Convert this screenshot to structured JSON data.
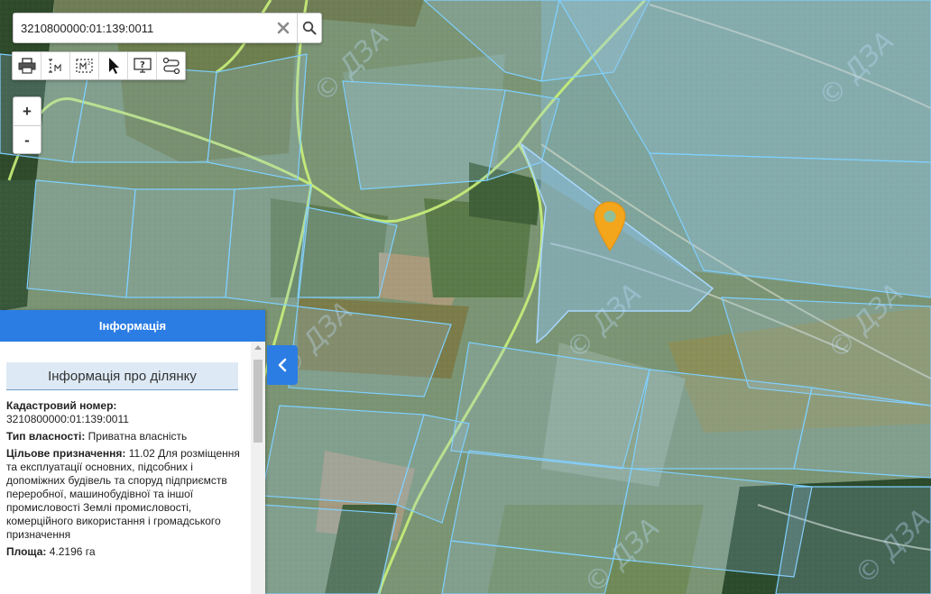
{
  "search": {
    "value": "3210800000:01:139:0011"
  },
  "toolbar": {
    "tools": [
      {
        "icon": "print-icon"
      },
      {
        "icon": "measure-distance-icon"
      },
      {
        "icon": "measure-area-icon"
      },
      {
        "icon": "pointer-icon"
      },
      {
        "icon": "help-icon"
      },
      {
        "icon": "route-icon"
      }
    ]
  },
  "zoom": {
    "in_label": "+",
    "out_label": "-"
  },
  "watermark": {
    "text": "© ДЗА"
  },
  "info": {
    "header": "Інформація",
    "section_title": "Інформація про ділянку",
    "cadastral_label": "Кадастровий номер:",
    "cadastral_value": "3210800000:01:139:0011",
    "ownership_label": "Тип власності:",
    "ownership_value": "Приватна власність",
    "purpose_label": "Цільове призначення:",
    "purpose_value": "11.02 Для розміщення та експлуатації основних, підсобних і допоміжних будівель та споруд підприємств переробної, машинобудівної та іншої промисловості Землі промисловості, комерційного використання і громадського призначення",
    "area_label": "Площа:",
    "area_value": "4.2196 га"
  },
  "colors": {
    "accent": "#2b7de4",
    "parcel_outline": "#7fd0ff",
    "selected_parcel": "#8ec4f0",
    "road": "#c9f07a",
    "marker": "#f3a51c"
  }
}
